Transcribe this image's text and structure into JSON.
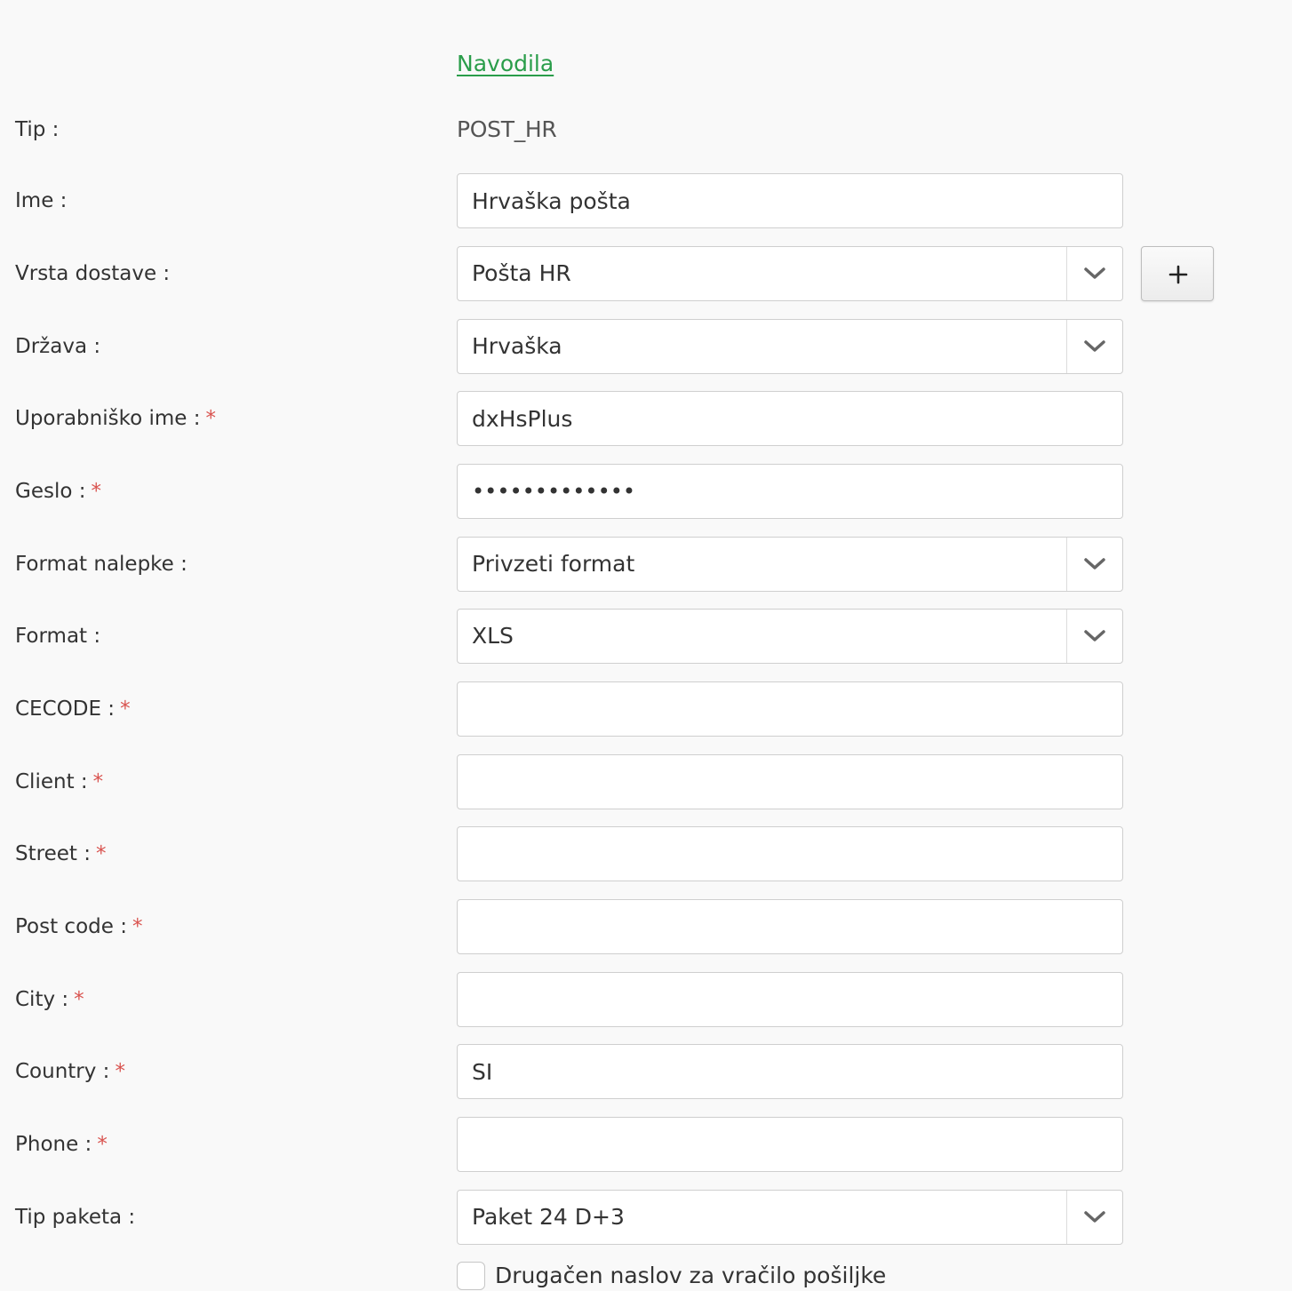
{
  "help_link": "Navodila",
  "fields": {
    "tip": {
      "label": "Tip :",
      "value": "POST_HR"
    },
    "ime": {
      "label": "Ime :",
      "value": "Hrvaška pošta"
    },
    "vrsta_dostave": {
      "label": "Vrsta dostave :",
      "value": "Pošta HR"
    },
    "drzava": {
      "label": "Država :",
      "value": "Hrvaška"
    },
    "uporabnisko_ime": {
      "label": "Uporabniško ime :",
      "value": "dxHsPlus"
    },
    "geslo": {
      "label": "Geslo :",
      "value": "•••••••••••••"
    },
    "format_nalepke": {
      "label": "Format nalepke :",
      "value": "Privzeti format"
    },
    "format": {
      "label": "Format :",
      "value": "XLS"
    },
    "cecode": {
      "label": "CECODE :",
      "value": ""
    },
    "client": {
      "label": "Client :",
      "value": ""
    },
    "street": {
      "label": "Street :",
      "value": ""
    },
    "post_code": {
      "label": "Post code :",
      "value": ""
    },
    "city": {
      "label": "City :",
      "value": ""
    },
    "country": {
      "label": "Country :",
      "value": "SI"
    },
    "phone": {
      "label": "Phone :",
      "value": ""
    },
    "tip_paketa": {
      "label": "Tip paketa :",
      "value": "Paket 24 D+3"
    }
  },
  "required_mark": "*",
  "add_button_label": "+",
  "return_address_checkbox": {
    "label": "Drugačen naslov za vračilo pošiljke",
    "checked": false
  },
  "colors": {
    "link": "#2a9d4a",
    "required": "#d9534f",
    "background": "#f9f9f9"
  },
  "icons": {
    "dropdown": "chevron-down-icon",
    "add": "plus-icon"
  }
}
